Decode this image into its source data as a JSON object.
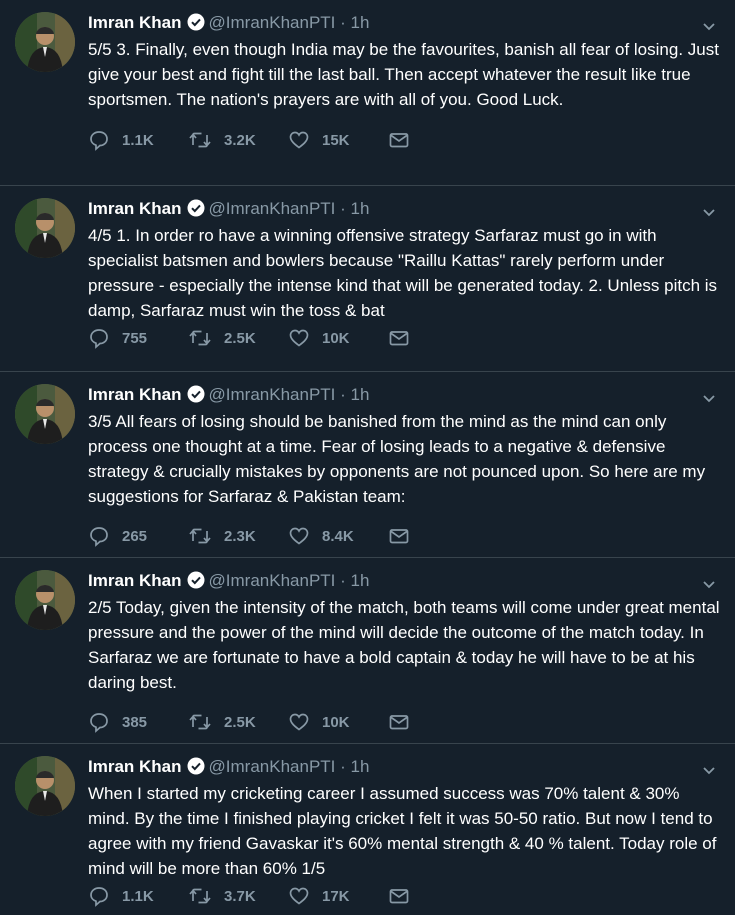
{
  "tweets": [
    {
      "name": "Imran Khan",
      "handle": "@ImranKhanPTI",
      "separator": "·",
      "time": "1h",
      "text": "5/5 3. Finally, even though India may be the favourites, banish all fear of losing. Just give your best and fight till the last ball. Then accept whatever the result like true sportsmen. The nation's prayers are with all of you. Good Luck.",
      "replies": "1.1K",
      "retweets": "3.2K",
      "likes": "15K"
    },
    {
      "name": "Imran Khan",
      "handle": "@ImranKhanPTI",
      "separator": "·",
      "time": "1h",
      "text": "4/5 1. In order ro have a winning offensive strategy Sarfaraz must go in with specialist batsmen and bowlers because \"Raillu Kattas\" rarely perform under pressure - especially the intense kind that will be generated today. 2. Unless pitch is damp, Sarfaraz must win the toss & bat",
      "replies": "755",
      "retweets": "2.5K",
      "likes": "10K"
    },
    {
      "name": "Imran Khan",
      "handle": "@ImranKhanPTI",
      "separator": "·",
      "time": "1h",
      "text": "3/5 All fears of losing should be banished from the mind as the mind can only process one thought at a time. Fear  of losing leads to a negative & defensive strategy & crucially mistakes by opponents are not pounced upon. So here are my suggestions for Sarfaraz & Pakistan team:",
      "replies": "265",
      "retweets": "2.3K",
      "likes": "8.4K"
    },
    {
      "name": "Imran Khan",
      "handle": "@ImranKhanPTI",
      "separator": "·",
      "time": "1h",
      "text": "2/5 Today, given the intensity of the match, both teams will come under great mental pressure and the power of the mind will decide the outcome of the match today. In Sarfaraz we are fortunate to have a bold captain & today he will have to be at his daring best.",
      "replies": "385",
      "retweets": "2.5K",
      "likes": "10K"
    },
    {
      "name": "Imran Khan",
      "handle": "@ImranKhanPTI",
      "separator": "·",
      "time": "1h",
      "text": "When I started my cricketing career I assumed success was 70% talent & 30% mind. By the time I finished playing cricket I felt it was 50-50 ratio. But now I tend to agree with my friend Gavaskar it's 60% mental strength & 40 % talent. Today role of mind will be more than 60% 1/5",
      "replies": "1.1K",
      "retweets": "3.7K",
      "likes": "17K"
    }
  ],
  "icons": {
    "reply": "reply-icon",
    "retweet": "retweet-icon",
    "like": "heart-icon",
    "share": "mail-icon",
    "more": "chevron-down-icon",
    "verified": "verified-badge-icon"
  },
  "colors": {
    "background": "#15202b",
    "divider": "#38444d",
    "secondary_text": "#8899a6",
    "primary_text": "#ffffff"
  }
}
